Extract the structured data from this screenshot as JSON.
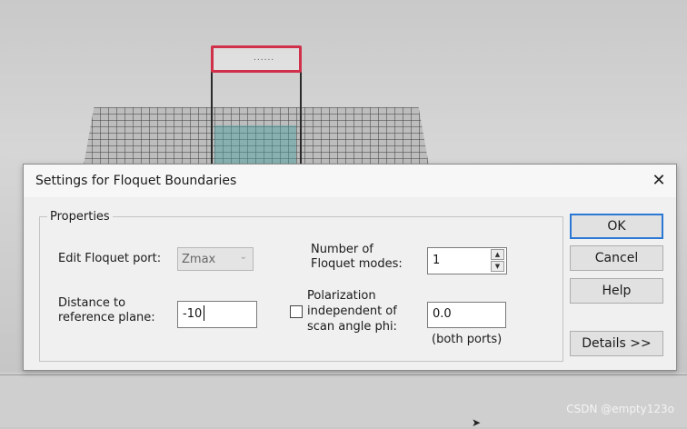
{
  "dialog": {
    "title": "Settings for Floquet Boundaries",
    "close_glyph": "✕",
    "group_label": "Properties",
    "edit_port_label": "Edit Floquet port:",
    "edit_port_value": "Zmax",
    "edit_port_arrow": "⌄",
    "distance_label_line1": "Distance to",
    "distance_label_line2": "reference plane:",
    "distance_value": "-10",
    "modes_label_line1": "Number of",
    "modes_label_line2": "Floquet modes:",
    "modes_value": "1",
    "spin_up": "▲",
    "spin_down": "▼",
    "polarization_line1": "Polarization",
    "polarization_line2": "independent of",
    "polarization_line3": "scan angle phi:",
    "polarization_checked": false,
    "polarization_value": "0.0",
    "both_ports": "(both ports)",
    "buttons": {
      "ok": "OK",
      "cancel": "Cancel",
      "help": "Help",
      "details": "Details >>"
    }
  },
  "viewport": {
    "port_dots": "......"
  },
  "watermark": "CSDN @empty123o",
  "colors": {
    "port_highlight": "#d0304a",
    "default_button_border": "#2a78d4",
    "dialog_background": "#f0f0f0"
  }
}
